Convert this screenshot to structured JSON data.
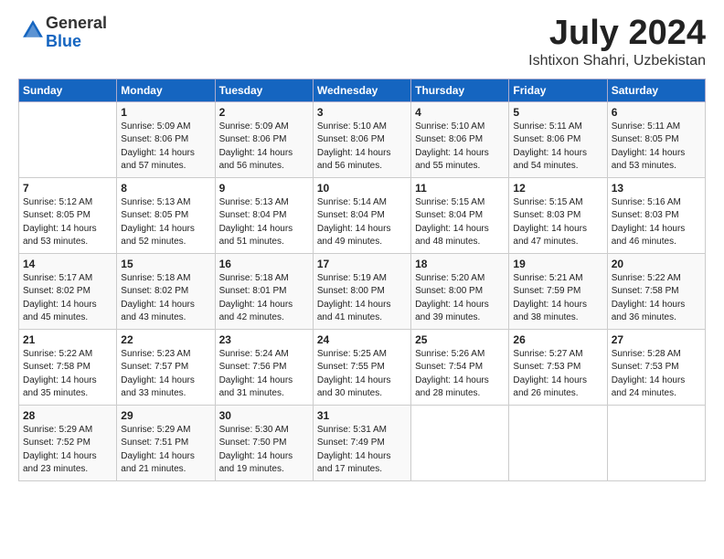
{
  "header": {
    "logo_general": "General",
    "logo_blue": "Blue",
    "title": "July 2024",
    "location": "Ishtixon Shahri, Uzbekistan"
  },
  "days_of_week": [
    "Sunday",
    "Monday",
    "Tuesday",
    "Wednesday",
    "Thursday",
    "Friday",
    "Saturday"
  ],
  "weeks": [
    [
      {
        "num": "",
        "info": ""
      },
      {
        "num": "1",
        "info": "Sunrise: 5:09 AM\nSunset: 8:06 PM\nDaylight: 14 hours\nand 57 minutes."
      },
      {
        "num": "2",
        "info": "Sunrise: 5:09 AM\nSunset: 8:06 PM\nDaylight: 14 hours\nand 56 minutes."
      },
      {
        "num": "3",
        "info": "Sunrise: 5:10 AM\nSunset: 8:06 PM\nDaylight: 14 hours\nand 56 minutes."
      },
      {
        "num": "4",
        "info": "Sunrise: 5:10 AM\nSunset: 8:06 PM\nDaylight: 14 hours\nand 55 minutes."
      },
      {
        "num": "5",
        "info": "Sunrise: 5:11 AM\nSunset: 8:06 PM\nDaylight: 14 hours\nand 54 minutes."
      },
      {
        "num": "6",
        "info": "Sunrise: 5:11 AM\nSunset: 8:05 PM\nDaylight: 14 hours\nand 53 minutes."
      }
    ],
    [
      {
        "num": "7",
        "info": "Sunrise: 5:12 AM\nSunset: 8:05 PM\nDaylight: 14 hours\nand 53 minutes."
      },
      {
        "num": "8",
        "info": "Sunrise: 5:13 AM\nSunset: 8:05 PM\nDaylight: 14 hours\nand 52 minutes."
      },
      {
        "num": "9",
        "info": "Sunrise: 5:13 AM\nSunset: 8:04 PM\nDaylight: 14 hours\nand 51 minutes."
      },
      {
        "num": "10",
        "info": "Sunrise: 5:14 AM\nSunset: 8:04 PM\nDaylight: 14 hours\nand 49 minutes."
      },
      {
        "num": "11",
        "info": "Sunrise: 5:15 AM\nSunset: 8:04 PM\nDaylight: 14 hours\nand 48 minutes."
      },
      {
        "num": "12",
        "info": "Sunrise: 5:15 AM\nSunset: 8:03 PM\nDaylight: 14 hours\nand 47 minutes."
      },
      {
        "num": "13",
        "info": "Sunrise: 5:16 AM\nSunset: 8:03 PM\nDaylight: 14 hours\nand 46 minutes."
      }
    ],
    [
      {
        "num": "14",
        "info": "Sunrise: 5:17 AM\nSunset: 8:02 PM\nDaylight: 14 hours\nand 45 minutes."
      },
      {
        "num": "15",
        "info": "Sunrise: 5:18 AM\nSunset: 8:02 PM\nDaylight: 14 hours\nand 43 minutes."
      },
      {
        "num": "16",
        "info": "Sunrise: 5:18 AM\nSunset: 8:01 PM\nDaylight: 14 hours\nand 42 minutes."
      },
      {
        "num": "17",
        "info": "Sunrise: 5:19 AM\nSunset: 8:00 PM\nDaylight: 14 hours\nand 41 minutes."
      },
      {
        "num": "18",
        "info": "Sunrise: 5:20 AM\nSunset: 8:00 PM\nDaylight: 14 hours\nand 39 minutes."
      },
      {
        "num": "19",
        "info": "Sunrise: 5:21 AM\nSunset: 7:59 PM\nDaylight: 14 hours\nand 38 minutes."
      },
      {
        "num": "20",
        "info": "Sunrise: 5:22 AM\nSunset: 7:58 PM\nDaylight: 14 hours\nand 36 minutes."
      }
    ],
    [
      {
        "num": "21",
        "info": "Sunrise: 5:22 AM\nSunset: 7:58 PM\nDaylight: 14 hours\nand 35 minutes."
      },
      {
        "num": "22",
        "info": "Sunrise: 5:23 AM\nSunset: 7:57 PM\nDaylight: 14 hours\nand 33 minutes."
      },
      {
        "num": "23",
        "info": "Sunrise: 5:24 AM\nSunset: 7:56 PM\nDaylight: 14 hours\nand 31 minutes."
      },
      {
        "num": "24",
        "info": "Sunrise: 5:25 AM\nSunset: 7:55 PM\nDaylight: 14 hours\nand 30 minutes."
      },
      {
        "num": "25",
        "info": "Sunrise: 5:26 AM\nSunset: 7:54 PM\nDaylight: 14 hours\nand 28 minutes."
      },
      {
        "num": "26",
        "info": "Sunrise: 5:27 AM\nSunset: 7:53 PM\nDaylight: 14 hours\nand 26 minutes."
      },
      {
        "num": "27",
        "info": "Sunrise: 5:28 AM\nSunset: 7:53 PM\nDaylight: 14 hours\nand 24 minutes."
      }
    ],
    [
      {
        "num": "28",
        "info": "Sunrise: 5:29 AM\nSunset: 7:52 PM\nDaylight: 14 hours\nand 23 minutes."
      },
      {
        "num": "29",
        "info": "Sunrise: 5:29 AM\nSunset: 7:51 PM\nDaylight: 14 hours\nand 21 minutes."
      },
      {
        "num": "30",
        "info": "Sunrise: 5:30 AM\nSunset: 7:50 PM\nDaylight: 14 hours\nand 19 minutes."
      },
      {
        "num": "31",
        "info": "Sunrise: 5:31 AM\nSunset: 7:49 PM\nDaylight: 14 hours\nand 17 minutes."
      },
      {
        "num": "",
        "info": ""
      },
      {
        "num": "",
        "info": ""
      },
      {
        "num": "",
        "info": ""
      }
    ]
  ]
}
